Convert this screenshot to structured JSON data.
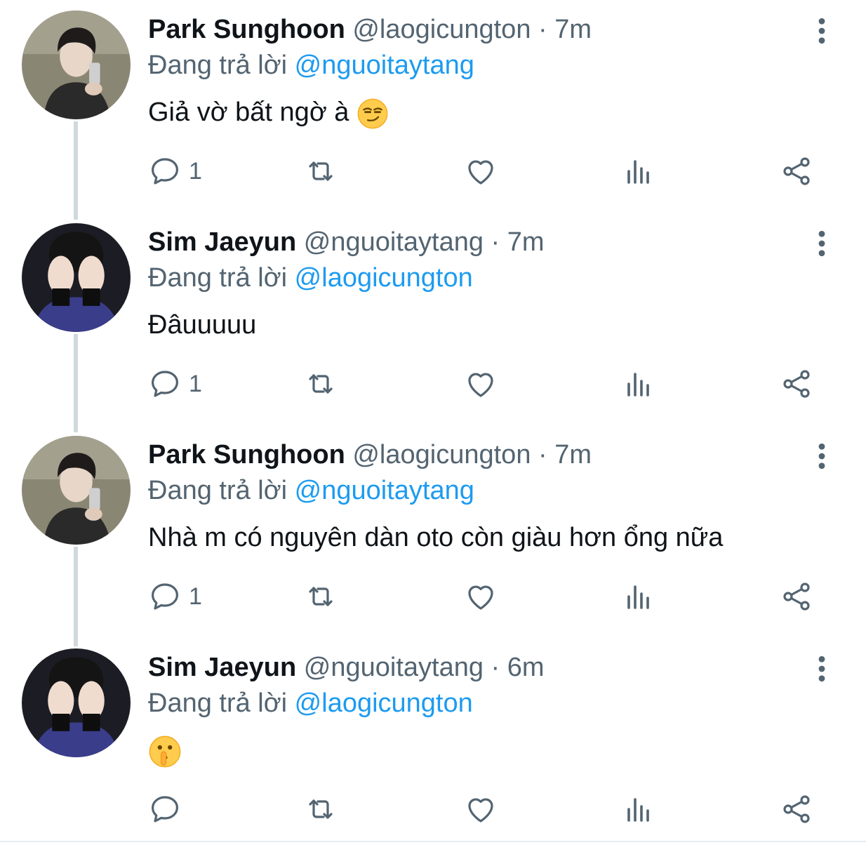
{
  "colors": {
    "accent": "#1d9bf0",
    "secondary_text": "#536471",
    "primary_text": "#0f1419",
    "thread_line": "#cfd9de"
  },
  "tweets": [
    {
      "name": "Park Sunghoon",
      "handle": "@laogicungton",
      "separator": "·",
      "time": "7m",
      "reply_prefix": "Đang trả lời",
      "reply_to": "@nguoitaytang",
      "text": "Giả vờ bất ngờ à",
      "emoji": "smirking-face",
      "reply_count": "1",
      "avatar": "avatar-sunghoon"
    },
    {
      "name": "Sim Jaeyun",
      "handle": "@nguoitaytang",
      "separator": "·",
      "time": "7m",
      "reply_prefix": "Đang trả lời",
      "reply_to": "@laogicungton",
      "text": "Đâuuuuu",
      "reply_count": "1",
      "avatar": "avatar-jaeyun"
    },
    {
      "name": "Park Sunghoon",
      "handle": "@laogicungton",
      "separator": "·",
      "time": "7m",
      "reply_prefix": "Đang trả lời",
      "reply_to": "@nguoitaytang",
      "text": "Nhà m có nguyên dàn oto còn giàu hơn ổng nữa",
      "reply_count": "1",
      "avatar": "avatar-sunghoon"
    },
    {
      "name": "Sim Jaeyun",
      "handle": "@nguoitaytang",
      "separator": "·",
      "time": "6m",
      "reply_prefix": "Đang trả lời",
      "reply_to": "@laogicungton",
      "text": "",
      "emoji": "shushing-face",
      "reply_count": "",
      "avatar": "avatar-jaeyun"
    }
  ]
}
